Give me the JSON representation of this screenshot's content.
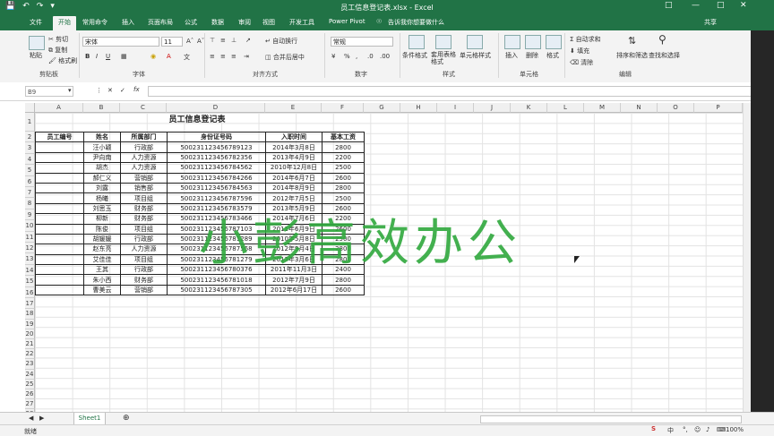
{
  "title": "员工信息登记表.xlsx - Excel",
  "share": "共享",
  "tabs": [
    "文件",
    "开始",
    "常用命令",
    "插入",
    "页面布局",
    "公式",
    "数据",
    "审阅",
    "视图",
    "开发工具",
    "Power Pivot"
  ],
  "tell_me": "告诉我你想要做什么",
  "ribbon": {
    "clipboard": {
      "label": "剪贴板",
      "cut": "剪切",
      "copy": "复制",
      "format_painter": "格式刷",
      "paste": "粘贴"
    },
    "font": {
      "label": "字体",
      "name": "宋体",
      "size": "11"
    },
    "alignment": {
      "label": "对齐方式",
      "wrap": "自动换行",
      "merge": "合并后居中"
    },
    "number": {
      "label": "数字",
      "format": "常规"
    },
    "styles": {
      "label": "样式",
      "conditional": "条件格式",
      "table": "套用表格格式",
      "cell_styles": "单元格样式"
    },
    "cells": {
      "label": "单元格",
      "insert": "插入",
      "delete": "删除",
      "format": "格式"
    },
    "editing": {
      "label": "编辑",
      "autosum": "自动求和",
      "fill": "填充",
      "clear": "清除",
      "sort": "排序和筛选",
      "find": "查找和选择"
    }
  },
  "namebox": "B9",
  "fx": "fx",
  "columns": [
    "A",
    "B",
    "C",
    "D",
    "E",
    "F",
    "G",
    "H",
    "I",
    "J",
    "K",
    "L",
    "M",
    "N",
    "O",
    "P"
  ],
  "sheet_title": "员工信息登记表",
  "table_headers": [
    "员工编号",
    "姓名",
    "所属部门",
    "身份证号码",
    "入职时间",
    "基本工资"
  ],
  "table_rows": [
    [
      "",
      "汪小颖",
      "行政部",
      "500231123456789123",
      "2014年3月8日",
      "2800"
    ],
    [
      "",
      "尹向南",
      "人力资源",
      "500231123456782356",
      "2013年4月9日",
      "2200"
    ],
    [
      "",
      "胡杰",
      "人力资源",
      "500231123456784562",
      "2010年12月8日",
      "2500"
    ],
    [
      "",
      "郝仁义",
      "营销部",
      "500231123456784266",
      "2014年6月7日",
      "2600"
    ],
    [
      "",
      "刘露",
      "销售部",
      "500231123456784563",
      "2014年8月9日",
      "2800"
    ],
    [
      "",
      "杨曦",
      "项目组",
      "500231123456787596",
      "2012年7月5日",
      "2500"
    ],
    [
      "",
      "刘思玉",
      "财务部",
      "500231123456783579",
      "2013年5月9日",
      "2600"
    ],
    [
      "",
      "柳新",
      "财务部",
      "500231123456783466",
      "2014年7月6日",
      "2200"
    ],
    [
      "",
      "陈俊",
      "项目组",
      "500231123456787103",
      "2011年6月9日",
      "2600"
    ],
    [
      "",
      "胡媛媛",
      "行政部",
      "500231123456781289",
      "2010年5月8日",
      "2500"
    ],
    [
      "",
      "赵东亮",
      "人力资源",
      "500231123456787568",
      "2012年9月4日",
      "2800"
    ],
    [
      "",
      "艾佳佳",
      "项目组",
      "500231123456781279",
      "2013年3月6日",
      "2800"
    ],
    [
      "",
      "王其",
      "行政部",
      "500231123456780376",
      "2011年11月3日",
      "2400"
    ],
    [
      "",
      "朱小西",
      "财务部",
      "500231123456781018",
      "2012年7月9日",
      "2800"
    ],
    [
      "",
      "曹美云",
      "营销部",
      "500231123456787305",
      "2012年6月17日",
      "2600"
    ]
  ],
  "watermark": "小彭高效办公",
  "sheet_tab": "Sheet1",
  "status": "就绪",
  "zoom": "100%",
  "ime": "中",
  "accent": "#217346"
}
